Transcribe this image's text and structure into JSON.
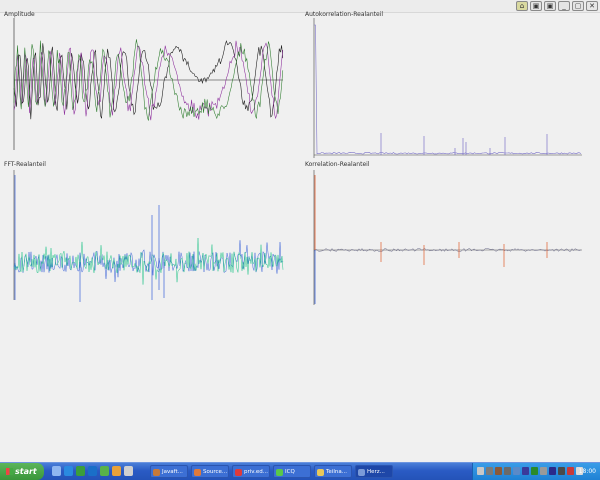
{
  "window": {
    "controls": [
      "⌂",
      "▣",
      "▣",
      "_",
      "▢",
      "✕"
    ]
  },
  "panels": {
    "amplitude": {
      "label": "Amplitude"
    },
    "autocorr": {
      "label": "Autokorrelation-Realanteil"
    },
    "fft": {
      "label": "FFT-Realanteil"
    },
    "korr": {
      "label": "Korrelation-Realanteil"
    }
  },
  "colors": {
    "amp_dark": "#111111",
    "amp_purple": "#8a2a9a",
    "amp_green": "#2a7a2a",
    "autocorr_line": "#7b72c8",
    "fft_blue": "#3a62d8",
    "fft_green": "#24c48a",
    "korr_line": "#6a6a8a",
    "korr_red": "#e05a2a",
    "taskbar": "#2a5bc4",
    "start": "#3a963a"
  },
  "taskbar": {
    "start_label": "start",
    "tasks": [
      {
        "label": "Javaft...",
        "icon": "coffee-icon"
      },
      {
        "label": "Source...",
        "icon": "globe-icon"
      },
      {
        "label": "priv.ed...",
        "icon": "doc-icon"
      },
      {
        "label": "ICQ",
        "icon": "flower-icon"
      },
      {
        "label": "Teilna...",
        "icon": "folder-icon"
      },
      {
        "label": "Herz...",
        "icon": "java-icon"
      }
    ],
    "clock": "18:00"
  }
}
